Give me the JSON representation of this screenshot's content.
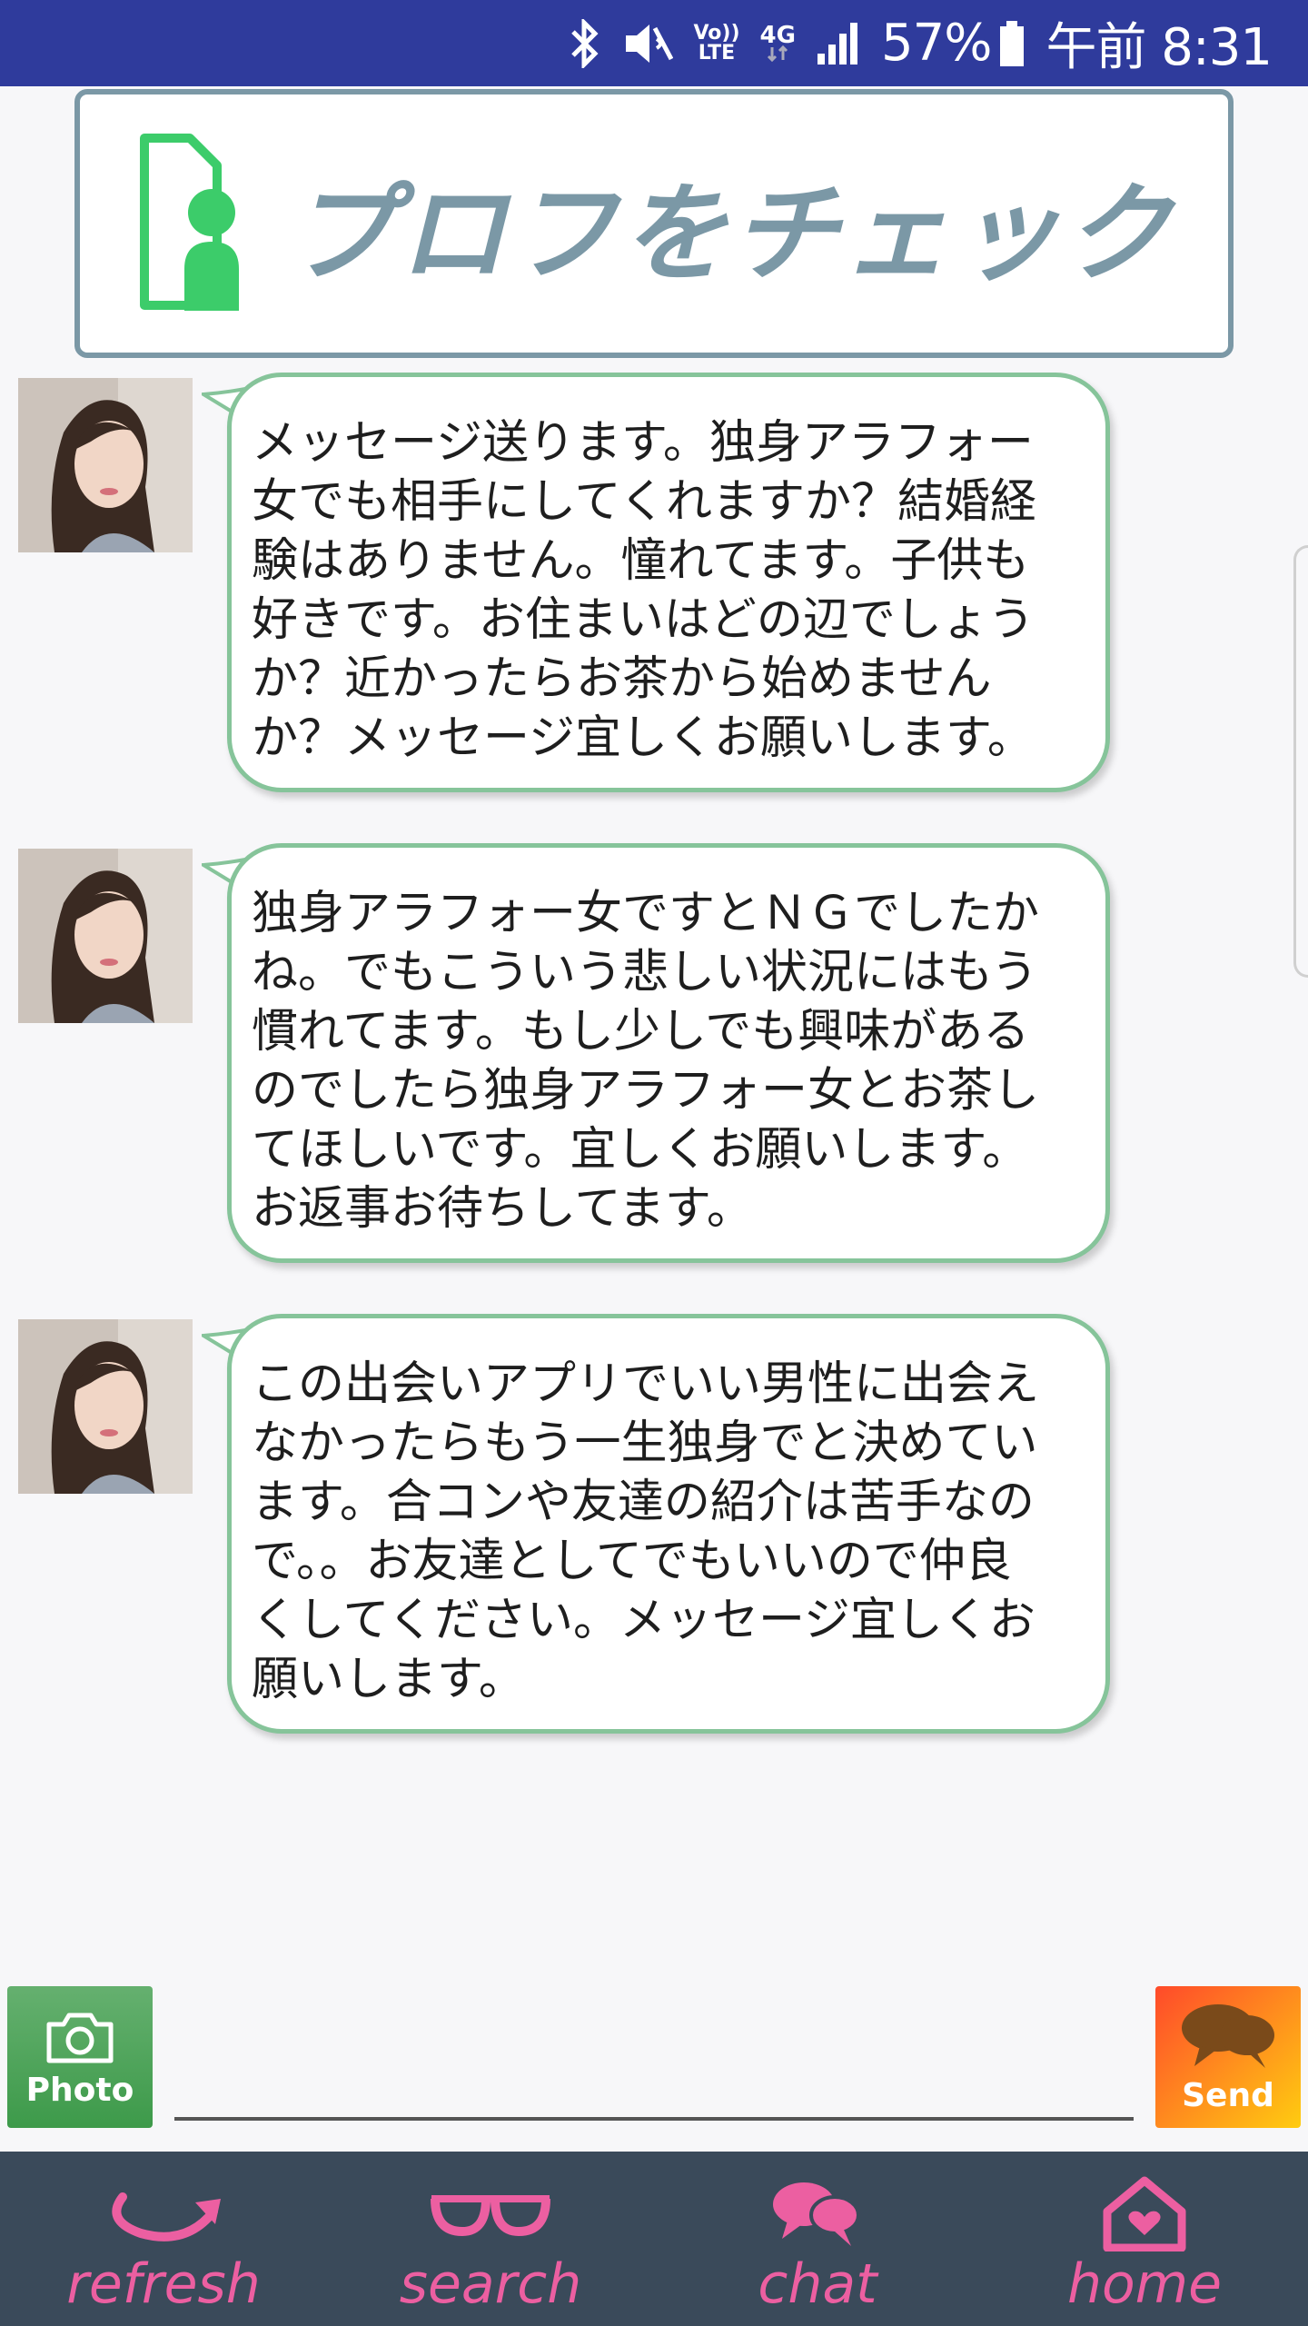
{
  "status_bar": {
    "volte_label": "Vo))\nLTE",
    "network_label": "4G",
    "battery": "57%",
    "time": "午前 8:31"
  },
  "profile_banner": {
    "label": "プロフをチェック"
  },
  "messages": [
    {
      "text": "メッセージ送ります。独身アラフォー\n女でも相手にしてくれますか？結婚経\n験はありません。憧れてます。子供も\n好きです。お住まいはどの辺でしょう\nか？近かったらお茶から始めません\nか？メッセージ宜しくお願いします。"
    },
    {
      "text": "独身アラフォー女ですとＮＧでしたか\nね。でもこういう悲しい状況にはもう\n慣れてます。もし少しでも興味がある\nのでしたら独身アラフォー女とお茶し\nてほしいです。宜しくお願いします。\nお返事お待ちしてます。"
    },
    {
      "text": "この出会いアプリでいい男性に出会え\nなかったらもう一生独身でと決めてい\nます。合コンや友達の紹介は苦手なの\nで。。お友達としてでもいいので仲良\nくしてください。メッセージ宜しくお\n願いします。"
    }
  ],
  "compose": {
    "photo_label": "Photo",
    "send_label": "Send",
    "input_value": "",
    "input_placeholder": ""
  },
  "nav": {
    "refresh": "refresh",
    "search": "search",
    "chat": "chat",
    "home": "home"
  },
  "colors": {
    "status_bar": "#2f3b9c",
    "banner_border": "#7b98a6",
    "bubble_border": "#86c49a",
    "nav_background": "#3a4a5a",
    "nav_accent": "#ec5fa1",
    "photo_button": "#4ea85a",
    "send_button": "#ff7a1e"
  }
}
